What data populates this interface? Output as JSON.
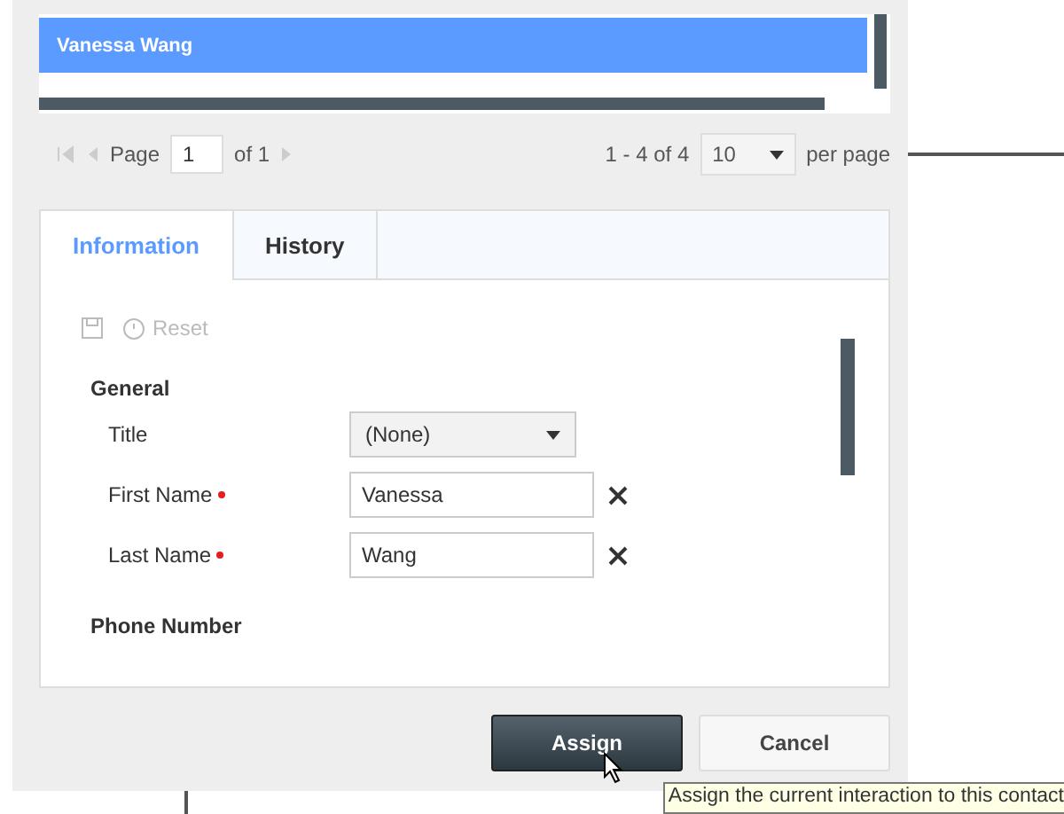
{
  "list": {
    "rows": [
      {
        "name": "Vanessa Wang",
        "selected": true
      }
    ]
  },
  "pager": {
    "page_label": "Page",
    "page": "1",
    "of": "of 1",
    "range": "1 - 4 of 4",
    "page_size": "10",
    "per_page": "per page"
  },
  "tabs": [
    {
      "label": "Information",
      "selected": true
    },
    {
      "label": "History",
      "selected": false
    }
  ],
  "toolbar": {
    "reset": "Reset",
    "disabled": true
  },
  "form": {
    "section": "General",
    "fields": [
      {
        "kind": "select",
        "label": "Title",
        "value": "(None)",
        "required": false
      },
      {
        "kind": "text",
        "label": "First Name",
        "value": "Vanessa",
        "required": true
      },
      {
        "kind": "text",
        "label": "Last Name",
        "value": "Wang",
        "required": true
      }
    ],
    "next_section": "Phone Number"
  },
  "buttons": [
    {
      "label": "Assign",
      "kind": "primary"
    },
    {
      "label": "Cancel",
      "kind": "secondary"
    }
  ],
  "tooltip": "Assign the current interaction to this contact"
}
